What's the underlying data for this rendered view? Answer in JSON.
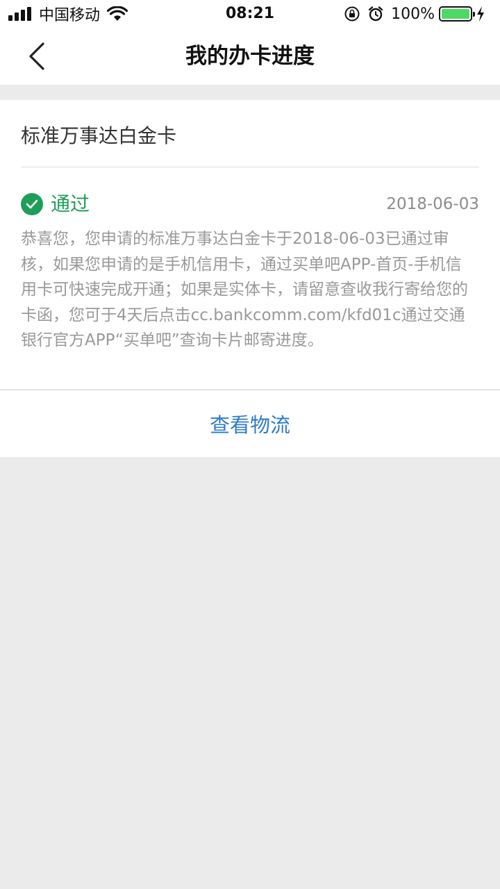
{
  "status_bar": {
    "carrier": "中国移动",
    "time": "08:21",
    "battery": "100%",
    "battery_level": 1.0
  },
  "nav": {
    "title": "我的办卡进度"
  },
  "card": {
    "title": "标准万事达白金卡",
    "status": "通过",
    "status_color": "#1f9e5a",
    "date": "2018-06-03",
    "description": "恭喜您，您申请的标准万事达白金卡于2018-06-03已通过审核，如果您申请的是手机信用卡，通过买单吧APP-首页-手机信用卡可快速完成开通；如果是实体卡，请留意查收我行寄给您的卡函，您可于4天后点击cc.bankcomm.com/kfd01c通过交通银行官方APP“买单吧”查询卡片邮寄进度。"
  },
  "action": {
    "label": "查看物流",
    "color": "#2e7cc8"
  },
  "icons": {
    "back": "chevron-left-icon",
    "status": "check-circle-icon",
    "wifi": "wifi-icon",
    "rotation_lock": "rotation-lock-icon",
    "alarm": "alarm-icon",
    "charging": "charging-bolt-icon"
  }
}
